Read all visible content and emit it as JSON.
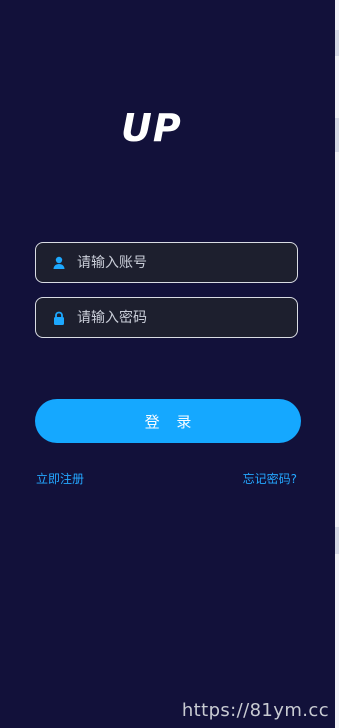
{
  "app": {
    "logo_text": "UP"
  },
  "login": {
    "account_placeholder": "请输入账号",
    "password_placeholder": "请输入密码",
    "button_label": "登 录",
    "register_link": "立即注册",
    "forgot_password_link": "忘记密码?"
  },
  "watermark": {
    "text": "https://81ym.cc"
  },
  "icons": {
    "user": "user-icon",
    "lock": "lock-icon"
  },
  "colors": {
    "background": "#12113a",
    "input_background": "#1d1f2e",
    "input_border": "#d9dce3",
    "accent": "#15a8ff",
    "link": "#24a7ff",
    "watermark": "#c8cbd2"
  }
}
